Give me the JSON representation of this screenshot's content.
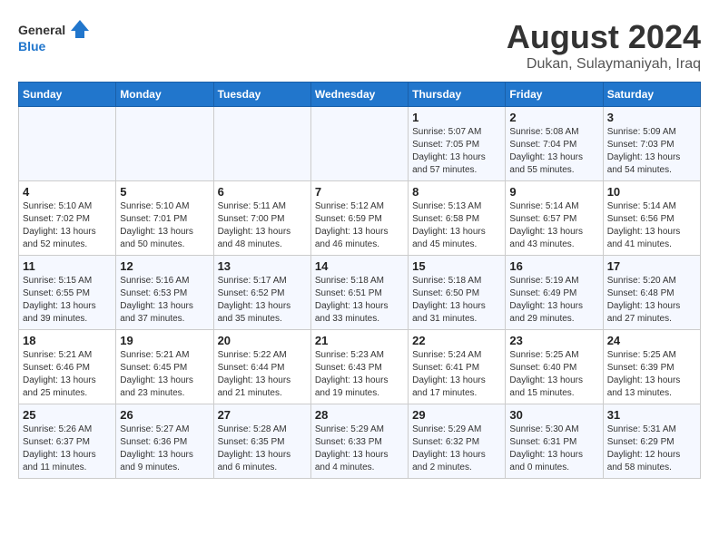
{
  "header": {
    "logo_general": "General",
    "logo_blue": "Blue",
    "title": "August 2024",
    "subtitle": "Dukan, Sulaymaniyah, Iraq"
  },
  "days_of_week": [
    "Sunday",
    "Monday",
    "Tuesday",
    "Wednesday",
    "Thursday",
    "Friday",
    "Saturday"
  ],
  "weeks": [
    [
      {
        "day": "",
        "info": ""
      },
      {
        "day": "",
        "info": ""
      },
      {
        "day": "",
        "info": ""
      },
      {
        "day": "",
        "info": ""
      },
      {
        "day": "1",
        "info": "Sunrise: 5:07 AM\nSunset: 7:05 PM\nDaylight: 13 hours\nand 57 minutes."
      },
      {
        "day": "2",
        "info": "Sunrise: 5:08 AM\nSunset: 7:04 PM\nDaylight: 13 hours\nand 55 minutes."
      },
      {
        "day": "3",
        "info": "Sunrise: 5:09 AM\nSunset: 7:03 PM\nDaylight: 13 hours\nand 54 minutes."
      }
    ],
    [
      {
        "day": "4",
        "info": "Sunrise: 5:10 AM\nSunset: 7:02 PM\nDaylight: 13 hours\nand 52 minutes."
      },
      {
        "day": "5",
        "info": "Sunrise: 5:10 AM\nSunset: 7:01 PM\nDaylight: 13 hours\nand 50 minutes."
      },
      {
        "day": "6",
        "info": "Sunrise: 5:11 AM\nSunset: 7:00 PM\nDaylight: 13 hours\nand 48 minutes."
      },
      {
        "day": "7",
        "info": "Sunrise: 5:12 AM\nSunset: 6:59 PM\nDaylight: 13 hours\nand 46 minutes."
      },
      {
        "day": "8",
        "info": "Sunrise: 5:13 AM\nSunset: 6:58 PM\nDaylight: 13 hours\nand 45 minutes."
      },
      {
        "day": "9",
        "info": "Sunrise: 5:14 AM\nSunset: 6:57 PM\nDaylight: 13 hours\nand 43 minutes."
      },
      {
        "day": "10",
        "info": "Sunrise: 5:14 AM\nSunset: 6:56 PM\nDaylight: 13 hours\nand 41 minutes."
      }
    ],
    [
      {
        "day": "11",
        "info": "Sunrise: 5:15 AM\nSunset: 6:55 PM\nDaylight: 13 hours\nand 39 minutes."
      },
      {
        "day": "12",
        "info": "Sunrise: 5:16 AM\nSunset: 6:53 PM\nDaylight: 13 hours\nand 37 minutes."
      },
      {
        "day": "13",
        "info": "Sunrise: 5:17 AM\nSunset: 6:52 PM\nDaylight: 13 hours\nand 35 minutes."
      },
      {
        "day": "14",
        "info": "Sunrise: 5:18 AM\nSunset: 6:51 PM\nDaylight: 13 hours\nand 33 minutes."
      },
      {
        "day": "15",
        "info": "Sunrise: 5:18 AM\nSunset: 6:50 PM\nDaylight: 13 hours\nand 31 minutes."
      },
      {
        "day": "16",
        "info": "Sunrise: 5:19 AM\nSunset: 6:49 PM\nDaylight: 13 hours\nand 29 minutes."
      },
      {
        "day": "17",
        "info": "Sunrise: 5:20 AM\nSunset: 6:48 PM\nDaylight: 13 hours\nand 27 minutes."
      }
    ],
    [
      {
        "day": "18",
        "info": "Sunrise: 5:21 AM\nSunset: 6:46 PM\nDaylight: 13 hours\nand 25 minutes."
      },
      {
        "day": "19",
        "info": "Sunrise: 5:21 AM\nSunset: 6:45 PM\nDaylight: 13 hours\nand 23 minutes."
      },
      {
        "day": "20",
        "info": "Sunrise: 5:22 AM\nSunset: 6:44 PM\nDaylight: 13 hours\nand 21 minutes."
      },
      {
        "day": "21",
        "info": "Sunrise: 5:23 AM\nSunset: 6:43 PM\nDaylight: 13 hours\nand 19 minutes."
      },
      {
        "day": "22",
        "info": "Sunrise: 5:24 AM\nSunset: 6:41 PM\nDaylight: 13 hours\nand 17 minutes."
      },
      {
        "day": "23",
        "info": "Sunrise: 5:25 AM\nSunset: 6:40 PM\nDaylight: 13 hours\nand 15 minutes."
      },
      {
        "day": "24",
        "info": "Sunrise: 5:25 AM\nSunset: 6:39 PM\nDaylight: 13 hours\nand 13 minutes."
      }
    ],
    [
      {
        "day": "25",
        "info": "Sunrise: 5:26 AM\nSunset: 6:37 PM\nDaylight: 13 hours\nand 11 minutes."
      },
      {
        "day": "26",
        "info": "Sunrise: 5:27 AM\nSunset: 6:36 PM\nDaylight: 13 hours\nand 9 minutes."
      },
      {
        "day": "27",
        "info": "Sunrise: 5:28 AM\nSunset: 6:35 PM\nDaylight: 13 hours\nand 6 minutes."
      },
      {
        "day": "28",
        "info": "Sunrise: 5:29 AM\nSunset: 6:33 PM\nDaylight: 13 hours\nand 4 minutes."
      },
      {
        "day": "29",
        "info": "Sunrise: 5:29 AM\nSunset: 6:32 PM\nDaylight: 13 hours\nand 2 minutes."
      },
      {
        "day": "30",
        "info": "Sunrise: 5:30 AM\nSunset: 6:31 PM\nDaylight: 13 hours\nand 0 minutes."
      },
      {
        "day": "31",
        "info": "Sunrise: 5:31 AM\nSunset: 6:29 PM\nDaylight: 12 hours\nand 58 minutes."
      }
    ]
  ]
}
